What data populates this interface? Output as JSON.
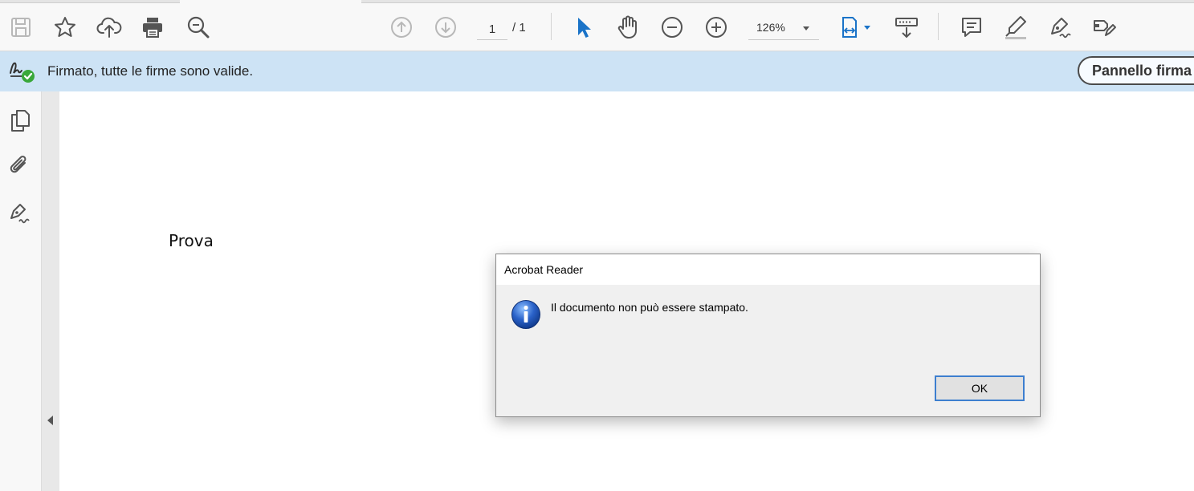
{
  "toolbar": {
    "current_page": "1",
    "page_total": "/ 1",
    "zoom": "126%",
    "icons": {
      "save": "save-icon",
      "bookmark": "star-icon",
      "upload": "cloud-upload-icon",
      "print": "printer-icon",
      "search": "zoom-search-icon",
      "prev_page": "arrow-up-circle-icon",
      "next_page": "arrow-down-circle-icon",
      "select": "cursor-arrow-icon",
      "hand": "hand-icon",
      "zoom_out": "minus-circle-icon",
      "zoom_in": "plus-circle-icon",
      "fit_page": "fit-width-icon",
      "scroll_mode": "scroll-mode-icon",
      "comment": "comment-icon",
      "highlight": "highlighter-icon",
      "sign": "fill-sign-icon",
      "more_tools": "edit-tool-icon"
    }
  },
  "signature_bar": {
    "message": "Firmato, tutte le firme sono valide.",
    "panel_button": "Pannello firma",
    "icon": "signature-valid-icon"
  },
  "left_rail": {
    "icons": [
      "page-thumbnails-icon",
      "attachment-icon",
      "signature-panel-icon"
    ]
  },
  "document": {
    "text": "Prova"
  },
  "dialog": {
    "title": "Acrobat Reader",
    "message": "Il documento non può essere stampato.",
    "ok_label": "OK",
    "icon": "info-icon"
  },
  "colors": {
    "accent": "#1a73c8",
    "signature_bar_bg": "#cde3f5",
    "valid_green": "#3aa83a"
  }
}
